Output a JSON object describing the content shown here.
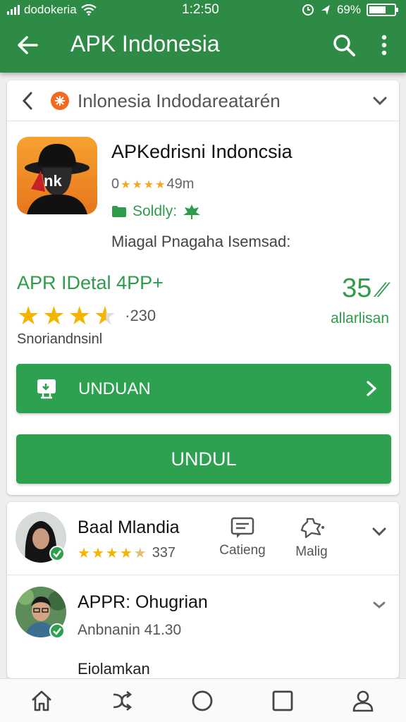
{
  "status_bar": {
    "carrier": "dodokeria",
    "time": "1:2:50",
    "battery": "69%",
    "battery_level": 0.69
  },
  "app_bar": {
    "title": "APK Indonesia",
    "back_icon": "arrow-back-icon",
    "search_icon": "search-icon",
    "more_icon": "more-vert-icon"
  },
  "breadcrumb": {
    "text": "Inlonesia Indodareatarén",
    "back_icon": "chevron-left-icon",
    "expand_icon": "chevron-down-icon"
  },
  "app": {
    "name": "APKedrisni Indoncsia",
    "rating_prefix": "0",
    "rating_suffix": "49m",
    "stars": 4,
    "safe_label": "Soldly:",
    "subtitle": "Miagal Pnagaha Isemsad:",
    "icon_text": "nk"
  },
  "details": {
    "title": "APR IDetal 4PP+",
    "rating": 3.5,
    "rating_count": "·230",
    "subtitle": "Snoriandnsinl",
    "big_number": "35",
    "big_number_suffix": "⁄⁄",
    "big_number_label": "allarlisan"
  },
  "buttons": {
    "primary_label": "UNDUAN",
    "secondary_label": "UNDUL"
  },
  "comments": [
    {
      "name": "Baal Mlandia",
      "stars": 4.5,
      "count": "337",
      "action1": "Catieng",
      "action2": "Malig"
    },
    {
      "name": "APPR: Ohugrian",
      "subtitle": "Anbnanin 41.30",
      "body": "Eiolamkan"
    }
  ],
  "bottom_nav": [
    "home-icon",
    "shuffle-icon",
    "circle-icon",
    "square-icon",
    "profile-icon"
  ],
  "colors": {
    "primary": "#2e8b45",
    "button": "#2ea151",
    "accent_text": "#2e9c4b",
    "star": "#f5b400"
  }
}
